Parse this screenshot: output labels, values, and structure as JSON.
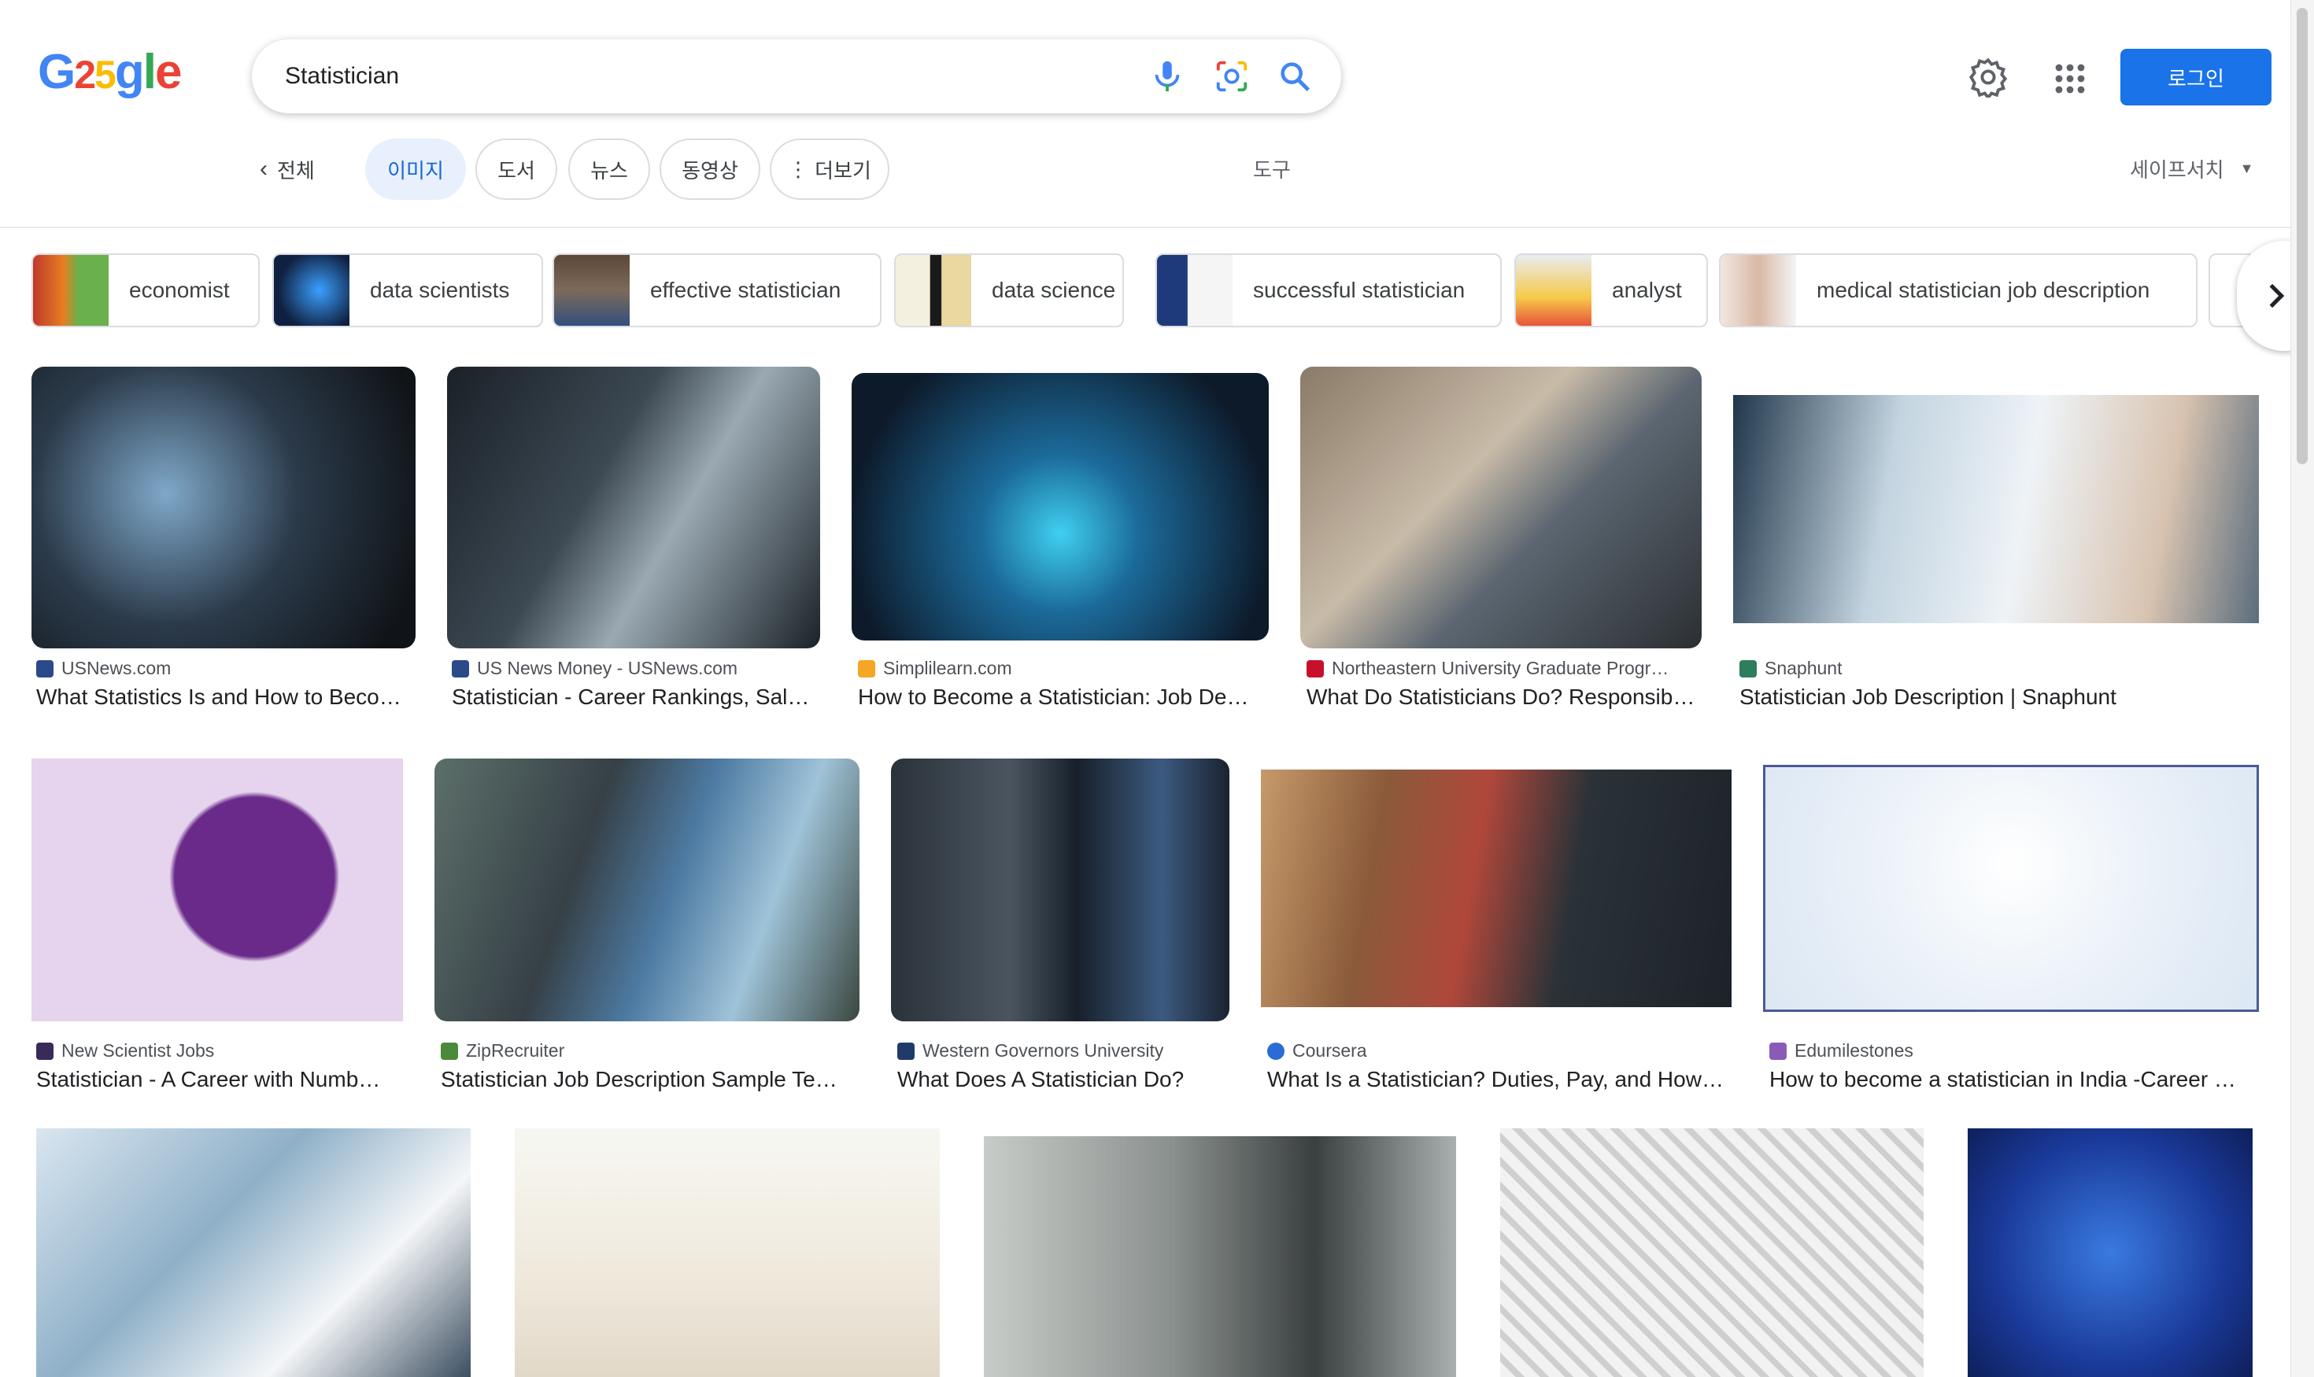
{
  "header": {
    "logo_text": "G25gle",
    "search_value": "Statistician",
    "login_label": "로그인",
    "icons": [
      "mic-icon",
      "lens-icon",
      "search-icon",
      "gear-icon",
      "apps-grid-icon"
    ]
  },
  "tabs": {
    "all_label": "전체",
    "items": [
      {
        "label": "이미지",
        "active": true
      },
      {
        "label": "도서"
      },
      {
        "label": "뉴스"
      },
      {
        "label": "동영상"
      },
      {
        "label": "더보기"
      }
    ],
    "tools_label": "도구",
    "safesearch_label": "세이프서치"
  },
  "chips": [
    {
      "label": "economist"
    },
    {
      "label": "data scientists"
    },
    {
      "label": "effective statistician"
    },
    {
      "label": "data science"
    },
    {
      "label": "successful statistician"
    },
    {
      "label": "analyst"
    },
    {
      "label": "medical statistician job description"
    }
  ],
  "results": [
    {
      "source": "USNews.com",
      "title": "What Statistics Is and How to Beco…"
    },
    {
      "source": "US News Money - USNews.com",
      "title": "Statistician - Career Rankings, Sal…"
    },
    {
      "source": "Simplilearn.com",
      "title": "How to Become a Statistician: Job De…"
    },
    {
      "source": "Northeastern University Graduate Progr…",
      "title": "What Do Statisticians Do? Responsib…"
    },
    {
      "source": "Snaphunt",
      "title": "Statistician Job Description | Snaphunt"
    },
    {
      "source": "New Scientist Jobs",
      "title": "Statistician - A Career with Numb…"
    },
    {
      "source": "ZipRecruiter",
      "title": "Statistician Job Description Sample Te…"
    },
    {
      "source": "Western Governors University",
      "title": "What Does A Statistician Do?"
    },
    {
      "source": "Coursera",
      "title": "What Is a Statistician? Duties, Pay, and How…"
    },
    {
      "source": "Edumilestones",
      "title": "How to become a statistician in India -Career …"
    },
    {
      "source": "",
      "title": ""
    },
    {
      "source": "",
      "title": ""
    },
    {
      "source": "",
      "title": ""
    },
    {
      "source": "",
      "title": ""
    },
    {
      "source": "",
      "title": ""
    }
  ]
}
